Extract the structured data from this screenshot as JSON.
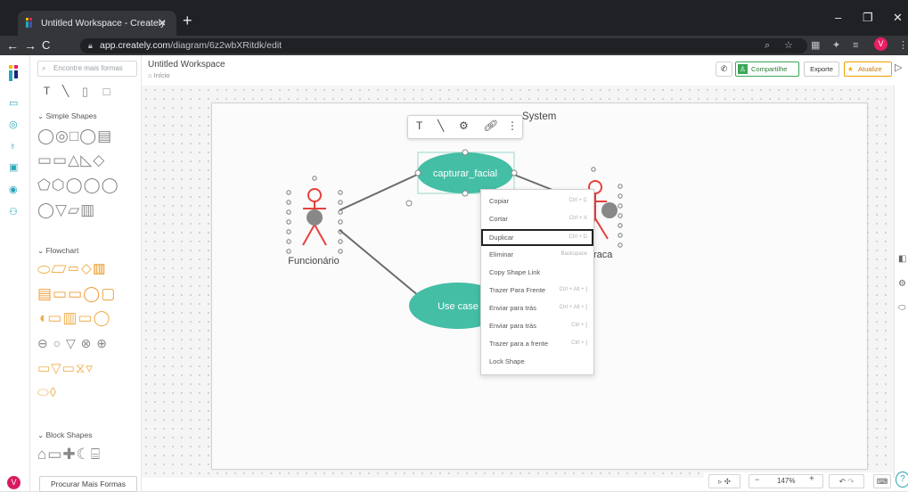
{
  "browser": {
    "tab_title": "Untitled Workspace - Creately",
    "tab_close": "×",
    "new_tab": "+",
    "url_host": "app.creately.com",
    "url_path": "/diagram/6z2wbXRitdk/edit",
    "profile_initial": "V",
    "win_minimize": "–",
    "win_restore": "❐",
    "win_close": "✕"
  },
  "app": {
    "doc_title": "Untitled Workspace",
    "breadcrumb_home": "Início",
    "user_initial": "V"
  },
  "shapes_panel": {
    "search_placeholder": "Encontre mais formas",
    "sections": [
      "Simple Shapes",
      "Flowchart",
      "Block Shapes"
    ],
    "more_shapes_button": "Procurar Mais Formas"
  },
  "header": {
    "share_label": "Compartilhe",
    "export_label": "Exporte",
    "upgrade_label": "Atualize"
  },
  "diagram": {
    "system_label": "System",
    "usecase_selected": "capturar_facial",
    "usecase_2": "Use case",
    "actor_left": "Funcionário",
    "actor_right_partial": "raca"
  },
  "context_menu": [
    {
      "label": "Copiar",
      "shortcut": "Ctrl + C"
    },
    {
      "label": "Cortar",
      "shortcut": "Ctrl + X"
    },
    {
      "label": "Duplicar",
      "shortcut": "Ctrl + D",
      "highlighted": true
    },
    {
      "label": "Eliminar",
      "shortcut": "Backspace"
    },
    {
      "label": "Copy Shape Link",
      "shortcut": ""
    },
    {
      "label": "Trazer Para Frente",
      "shortcut": "Ctrl + Alt + ]"
    },
    {
      "label": "Enviar para trás",
      "shortcut": "Ctrl + Alt + ["
    },
    {
      "label": "Enviar para trás",
      "shortcut": "Ctrl + ["
    },
    {
      "label": "Trazer para a frente",
      "shortcut": "Ctrl + ]"
    },
    {
      "label": "Lock Shape",
      "shortcut": ""
    }
  ],
  "bottom_bar": {
    "zoom_level": "147%",
    "zoom_out": "−",
    "zoom_in": "+"
  },
  "colors": {
    "usecase_fill": "#44bea5",
    "actor_stroke": "#e8403c",
    "accent_green": "#3aa657",
    "accent_teal": "#2aa5b8"
  },
  "icons": {
    "text_tool": "T",
    "line_tool": "╲",
    "more": "⋮",
    "help": "?"
  }
}
